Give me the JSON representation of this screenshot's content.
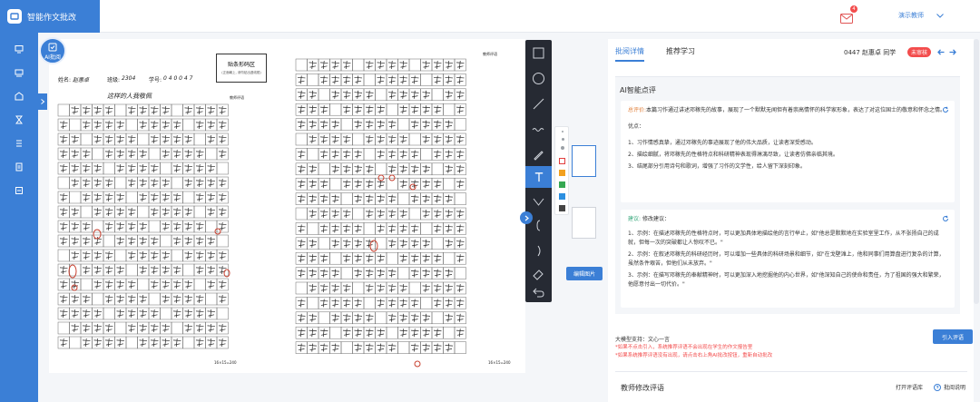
{
  "app": {
    "brand": "智能作文批改",
    "user_name": "演示教师",
    "mail_count": "4"
  },
  "paper": {
    "left_header": {
      "name_label": "姓名:",
      "name_value": "赵惠卓",
      "class_label": "班级:",
      "class_value": "2304",
      "id_label": "学号:",
      "id_value": "0 4 0 0 4 7",
      "title_box": "贴条形码区",
      "title_box_sub": "(正面朝上, 请勿贴出虚线框)",
      "comment_label": "教师评语",
      "essay_title": "这样的人我敬佩",
      "footer": "16×15=240"
    },
    "right_header": {
      "comment_label": "教师评语",
      "footer": "16×15=240"
    }
  },
  "toolbar": {
    "edit_image": "编辑图片"
  },
  "right": {
    "tabs": [
      "批阅详情",
      "推荐学习"
    ],
    "student": "0447 赵惠卓 同学",
    "status_badge": "未审核",
    "ai_title": "AI智能点评",
    "summary_tag": "总评价:",
    "summary": "本篇习作通过讲述邓稼先的故事，展现了一个默默无闻但有着崇高情怀的科学家形象，表达了对这位国士的敬意和怀念之情。",
    "strengths_title": "优点：",
    "strengths": [
      "1、习作情感真挚，通过邓稼先的事迹展现了他的伟大品质，让读者深受感动。",
      "2、描绘细腻，将邓稼先的性格特点和科研精神表现得淋漓尽致，让读者仿佛亲临其境。",
      "3、结尾部分引用诗句和歌词，增强了习作的文学性，给人留下深刻印象。"
    ],
    "suggest_tag": "建议:",
    "suggest_title": "修改建议：",
    "suggestions": [
      "1、示例：在描述邓稼先的性格特点时，可以更加具体地描绘他的言行举止，如\"他总是默默地在实验室里工作，从不张扬自己的成就，但每一次的突破都让人惊叹不已。\"",
      "2、示例：在叙述邓稼先的科研经历时，可以增加一些具体的科研场景和细节，如\"在戈壁滩上，他和同事们用算盘进行复杂的计算，虽然条件艰苦，但他们从未放弃。\"",
      "3、示例：在描写邓稼先的奉献精神时，可以更加深入地挖掘他的内心世界，如\"他深知自己的使命和责任，为了祖国的强大和繁荣，他愿意付出一切代价。\""
    ],
    "model_label": "大模型支持：文心一言",
    "notes": [
      "*如果不点击引入，系统推荐评语不会出现在学生的作文报告里",
      "*如果系统推荐评语没有出现，请点击右上角AI批改按钮，重新自动批改"
    ],
    "cite_button": "引入评语",
    "teacher_title": "教师修改评语",
    "open_comment_lib": "打开评语库",
    "help": "批阅说明"
  },
  "colors": {
    "primary": "#3b7fd6",
    "danger": "#f34d4d",
    "grid_red": "#c8402f",
    "ink": "#222222"
  }
}
